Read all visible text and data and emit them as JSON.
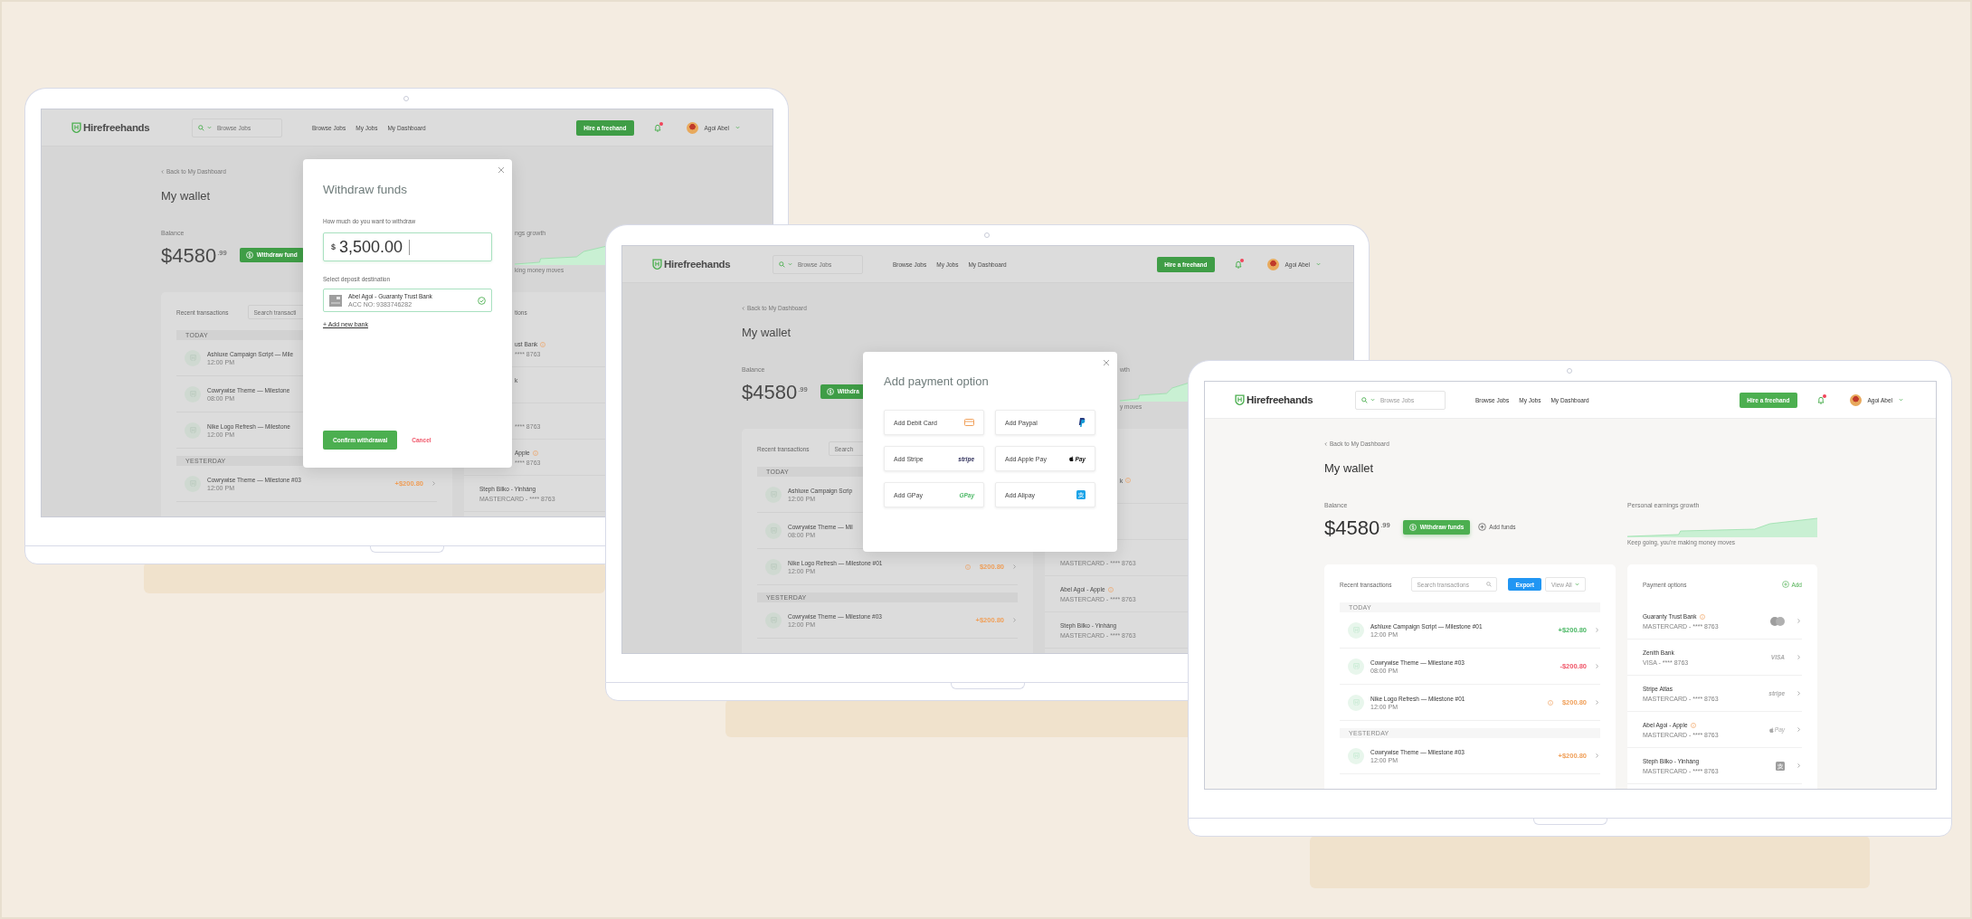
{
  "laptops": [
    {
      "screen": {
        "dimmed": true,
        "header": {
          "logo": "Hirefreehands",
          "search_placeholder": "Browse Jobs",
          "nav": [
            "Browse Jobs",
            "My Jobs",
            "My Dashboard"
          ],
          "hire_button": "Hire a freehand",
          "unread": true,
          "user": "Agoi Abel"
        },
        "back_link": "Back to My Dashboard",
        "title": "My wallet",
        "balance": {
          "label": "Balance",
          "amount": "$4580",
          "cents": ".99",
          "withdraw_button": "Withdraw fund"
        },
        "earnings": {
          "title": "ngs growth",
          "caption": "king money moves"
        },
        "transactions": {
          "title": "Recent transactions",
          "search_placeholder": "Search transacti",
          "groups": [
            {
              "label": "TODAY",
              "rows": [
                {
                  "title": "Ashluxe Campaign Script — Mile",
                  "time": "12:00 PM"
                },
                {
                  "title": "Cowrywise Theme — Milestone",
                  "time": "08:00 PM"
                },
                {
                  "title": "Nike Logo Refresh — Milestone",
                  "time": "12:00 PM"
                }
              ]
            },
            {
              "label": "YESTERDAY",
              "rows": [
                {
                  "title": "Cowrywise Theme — Milestone #03",
                  "time": "12:00 PM",
                  "amount": "+$200.80",
                  "color": "#f0a05a",
                  "chevron": true
                }
              ]
            }
          ]
        },
        "payment_options": {
          "title": "tions",
          "rows": [
            {
              "name": "ust Bank",
              "info": true,
              "sub": "**** 8763"
            },
            {
              "name": "k"
            },
            {
              "sub": "**** 8763"
            },
            {
              "name": "Apple",
              "info": true,
              "sub": "**** 8763"
            },
            {
              "name": "Steph Bilko - Yinháng",
              "sub": "MASTERCARD - **** 8763"
            }
          ]
        },
        "modal": {
          "kind": "withdraw",
          "title": "Withdraw funds",
          "amount_label": "How much do you want to withdraw",
          "currency": "$",
          "amount": "3,500.00",
          "destination_label": "Select deposit destination",
          "destination": {
            "name": "Abel Agoi - Guaranty Trust Bank",
            "account": "ACC NO: 9383746282",
            "selected": true
          },
          "add_bank": "+ Add new bank",
          "confirm": "Confirm withdrawal",
          "cancel": "Cancel"
        }
      }
    },
    {
      "screen": {
        "dimmed": true,
        "header": {
          "logo": "Hirefreehands",
          "search_placeholder": "Browse Jobs",
          "nav": [
            "Browse Jobs",
            "My Jobs",
            "My Dashboard"
          ],
          "hire_button": "Hire a freehand",
          "unread": true,
          "user": "Agoi Abel"
        },
        "back_link": "Back to My Dashboard",
        "title": "My wallet",
        "balance": {
          "label": "Balance",
          "amount": "$4580",
          "cents": ".99",
          "withdraw_button": "Withdra"
        },
        "earnings": {
          "title": "wth",
          "caption": "y moves"
        },
        "transactions": {
          "title": "Recent transactions",
          "search_placeholder": "Search",
          "groups": [
            {
              "label": "TODAY",
              "rows": [
                {
                  "title": "Ashluxe Campaign Scrip",
                  "time": "12:00 PM"
                },
                {
                  "title": "Cowrywise Theme — Mil",
                  "time": "08:00 PM"
                },
                {
                  "title": "Nike Logo Refresh — Milestone #01",
                  "time": "12:00 PM",
                  "info": true,
                  "amount": "$200.80",
                  "color": "#f0a05a",
                  "chevron": true
                }
              ]
            },
            {
              "label": "YESTERDAY",
              "rows": [
                {
                  "title": "Cowrywise Theme — Milestone #03",
                  "time": "12:00 PM",
                  "amount": "+$200.80",
                  "color": "#f0a05a",
                  "chevron": true
                }
              ]
            }
          ]
        },
        "payment_options": {
          "rows": [
            {
              "name": "k",
              "info": true
            },
            null,
            {
              "sub": "MASTERCARD - **** 8763"
            },
            {
              "name": "Abel Agoi - Apple",
              "info": true,
              "sub": "MASTERCARD - **** 8763"
            },
            {
              "name": "Steph Bilko - Yinháng",
              "sub": "MASTERCARD - **** 8763"
            }
          ]
        },
        "modal": {
          "kind": "add_payment",
          "title": "Add payment option",
          "options": [
            {
              "label": "Add Debit Card",
              "logo": {
                "kind": "card"
              }
            },
            {
              "label": "Add Paypal",
              "logo": {
                "kind": "paypal"
              }
            },
            {
              "label": "Add Stripe",
              "logo": {
                "kind": "stripe",
                "text": "stripe"
              }
            },
            {
              "label": "Add Apple Pay",
              "logo": {
                "kind": "applepay",
                "text": "Pay"
              }
            },
            {
              "label": "Add GPay",
              "logo": {
                "kind": "gpay",
                "text": "GPay"
              }
            },
            {
              "label": "Add Alipay",
              "logo": {
                "kind": "alipay"
              }
            }
          ]
        }
      }
    },
    {
      "screen": {
        "dimmed": false,
        "header": {
          "logo": "Hirefreehands",
          "search_placeholder": "Browse Jobs",
          "nav": [
            "Browse Jobs",
            "My Jobs",
            "My Dashboard"
          ],
          "hire_button": "Hire a freehand",
          "unread": true,
          "user": "Agoi Abel"
        },
        "back_link": "Back to My Dashboard",
        "title": "My wallet",
        "balance": {
          "label": "Balance",
          "amount": "$4580",
          "cents": ".99",
          "withdraw_button": "Withdraw funds",
          "add_funds": "Add funds"
        },
        "earnings": {
          "title": "Personal earnings growth",
          "caption": "Keep going, you're making money moves"
        },
        "transactions": {
          "title": "Recent transactions",
          "search_placeholder": "Search transactions",
          "export": "Export",
          "view_all": "View All",
          "groups": [
            {
              "label": "TODAY",
              "rows": [
                {
                  "title": "Ashluxe Campaign Script — Milestone #01",
                  "time": "12:00 PM",
                  "amount": "+$200.80",
                  "color": "#4cb866",
                  "chevron": true
                },
                {
                  "title": "Cowrywise Theme — Milestone #03",
                  "time": "08:00 PM",
                  "amount": "-$200.80",
                  "color": "#f0576a",
                  "chevron": true
                },
                {
                  "title": "Nike Logo Refresh — Milestone #01",
                  "time": "12:00 PM",
                  "info": true,
                  "amount": "$200.80",
                  "color": "#f0a05a",
                  "chevron": true
                }
              ]
            },
            {
              "label": "YESTERDAY",
              "rows": [
                {
                  "title": "Cowrywise Theme — Milestone #03",
                  "time": "12:00 PM",
                  "amount": "+$200.80",
                  "color": "#f0a05a",
                  "chevron": true
                }
              ]
            }
          ]
        },
        "payment_options": {
          "title": "Payment options",
          "add": "Add",
          "rows": [
            {
              "name": "Guaranty Trust Bank",
              "info": true,
              "sub": "MASTERCARD - **** 8763",
              "logo": {
                "kind": "mastercard"
              },
              "chevron": true
            },
            {
              "name": "Zenith Bank",
              "sub": "VISA - **** 8763",
              "logo": {
                "kind": "visa",
                "text": "VISA"
              },
              "chevron": true
            },
            {
              "name": "Stripe Atlas",
              "sub": "MASTERCARD - **** 8763",
              "logo": {
                "kind": "stripe",
                "text": "stripe"
              },
              "chevron": true
            },
            {
              "name": "Abel Agoi - Apple",
              "info": true,
              "sub": "MASTERCARD - **** 8763",
              "logo": {
                "kind": "applepay",
                "text": "Pay"
              },
              "chevron": true
            },
            {
              "name": "Steph Bilko - Yinháng",
              "sub": "MASTERCARD - **** 8763",
              "logo": {
                "kind": "alipay"
              },
              "chevron": true
            }
          ]
        }
      }
    }
  ]
}
